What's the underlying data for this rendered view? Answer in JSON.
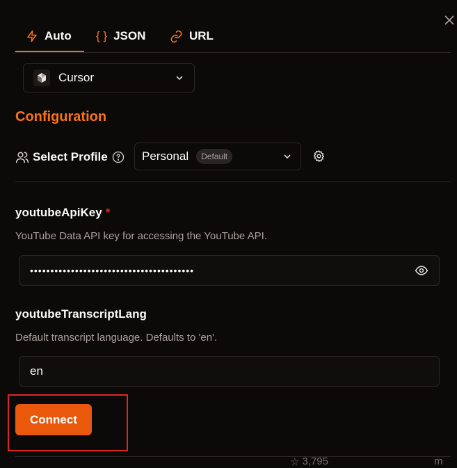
{
  "tabs": [
    {
      "label": "Auto",
      "icon": "lightning-icon",
      "active": true
    },
    {
      "label": "JSON",
      "icon": "braces-icon",
      "active": false
    },
    {
      "label": "URL",
      "icon": "link-icon",
      "active": false
    }
  ],
  "client": {
    "label": "Cursor",
    "icon": "cursor-logo-icon"
  },
  "config": {
    "title": "Configuration",
    "profile_label": "Select Profile",
    "profile_value": "Personal",
    "profile_badge": "Default"
  },
  "fields": {
    "api_key": {
      "label": "youtubeApiKey",
      "required_mark": "*",
      "description": "YouTube Data API key for accessing the YouTube API.",
      "value_masked": "••••••••••••••••••••••••••••••••••••••••"
    },
    "transcript_lang": {
      "label": "youtubeTranscriptLang",
      "description": "Default transcript language. Defaults to 'en'.",
      "value": "en"
    }
  },
  "connect_label": "Connect",
  "footer": {
    "stars": "3,795",
    "partial": "m"
  },
  "colors": {
    "accent": "#f97316",
    "button": "#ea580c",
    "highlight": "#dc2626",
    "background": "#0c0a09"
  }
}
